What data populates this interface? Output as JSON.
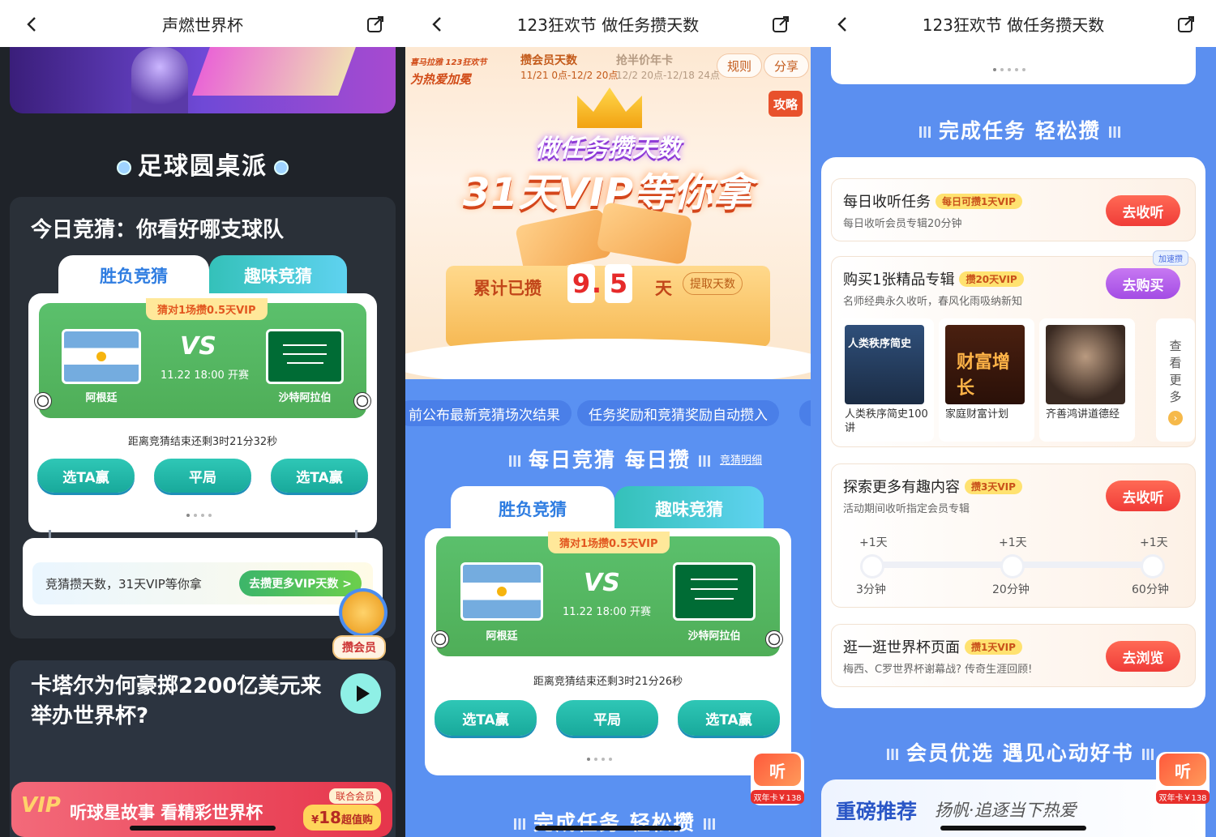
{
  "panel1": {
    "nav_title": "声燃世界杯",
    "section_title": "足球圆桌派",
    "card_title": "今日竞猜：你看好哪支球队",
    "tabs": [
      "胜负竞猜",
      "趣味竞猜"
    ],
    "match": {
      "reward": "猜对1场攒0.5天VIP",
      "team_home": "阿根廷",
      "team_away": "沙特阿拉伯",
      "vs": "VS",
      "time": "11.22  18:00  开赛",
      "countdown": "距离竞猜结束还剩3时21分32秒",
      "buttons": [
        "选TA赢",
        "平局",
        "选TA赢"
      ]
    },
    "promo_text": "竞猜攒天数，31天VIP等你拿",
    "promo_button": "去攒更多VIP天数 >",
    "member_badge": "攒会员",
    "video_title": "卡塔尔为何豪掷2200亿美元来举办世界杯?",
    "ad": {
      "vip": "VIP",
      "text": "听球星故事 看精彩世界杯",
      "tag": "联合会员",
      "price_prefix": "¥",
      "price": "18",
      "price_suffix": "超值购"
    }
  },
  "panel2": {
    "nav_title": "123狂欢节 做任务攒天数",
    "brand_line1": "喜马拉雅 123狂欢节",
    "brand_line2": "为热爱加冕",
    "timeline": [
      {
        "title": "攒会员天数",
        "date": "11/21 0点-12/2 20点"
      },
      {
        "title": "抢半价年卡",
        "date": "12/2 20点-12/18 24点"
      }
    ],
    "rules": "规则",
    "share": "分享",
    "strategy": "攻略",
    "headline1": "做任务攒天数",
    "headline2": "31天VIP等你拿",
    "accum_label": "累计已攒",
    "digits": [
      "9",
      ".",
      "5"
    ],
    "day_label": "天",
    "withdraw": "提取天数",
    "ticker": [
      "前公布最新竞猜场次结果",
      "任务奖励和竞猜奖励自动攒入"
    ],
    "section1": "每日竞猜 每日攒",
    "detail_link": "竞猜明细",
    "tabs": [
      "胜负竞猜",
      "趣味竞猜"
    ],
    "match": {
      "reward": "猜对1场攒0.5天VIP",
      "team_home": "阿根廷",
      "team_away": "沙特阿拉伯",
      "vs": "VS",
      "time": "11.22  18:00  开赛",
      "countdown": "距离竞猜结束还剩3时21分26秒",
      "buttons": [
        "选TA赢",
        "平局",
        "选TA赢"
      ]
    },
    "section2": "完成任务 轻松攒",
    "float_ad": {
      "top": "听",
      "bottom": "双年卡￥138"
    }
  },
  "panel3": {
    "nav_title": "123狂欢节 做任务攒天数",
    "section1": "完成任务 轻松攒",
    "tasks": [
      {
        "name": "每日收听任务",
        "badge": "每日可攒1天VIP",
        "desc": "每日收听会员专辑20分钟",
        "button": "去收听"
      },
      {
        "name": "购买1张精品专辑",
        "badge": "攒20天VIP",
        "desc": "名师经典永久收听，春风化雨吸纳新知",
        "button": "去购买",
        "tag": "加速攒"
      },
      {
        "name": "探索更多有趣内容",
        "badge": "攒3天VIP",
        "desc": "活动期间收听指定会员专辑",
        "button": "去收听"
      },
      {
        "name": "逛一逛世界杯页面",
        "badge": "攒1天VIP",
        "desc": "梅西、C罗世界杯谢幕战? 传奇生涯回顾!",
        "button": "去浏览"
      }
    ],
    "albums": [
      {
        "cover_text": "人类秩序简史",
        "caption": "人类秩序简史100讲"
      },
      {
        "cover_text": "财富增长",
        "caption": "家庭财富计划"
      },
      {
        "cover_text": "",
        "caption": "齐善鸿讲道德经"
      }
    ],
    "see_more": [
      "查",
      "看",
      "更",
      "多"
    ],
    "progress": [
      {
        "reward": "+1天",
        "time": "3分钟"
      },
      {
        "reward": "+1天",
        "time": "20分钟"
      },
      {
        "reward": "+1天",
        "time": "60分钟"
      }
    ],
    "section2": "会员优选 遇见心动好书",
    "book_title": "重磅推荐",
    "book_sub": "扬帆·追逐当下热爱",
    "float_ad": {
      "top": "听",
      "bottom": "双年卡￥138"
    }
  }
}
